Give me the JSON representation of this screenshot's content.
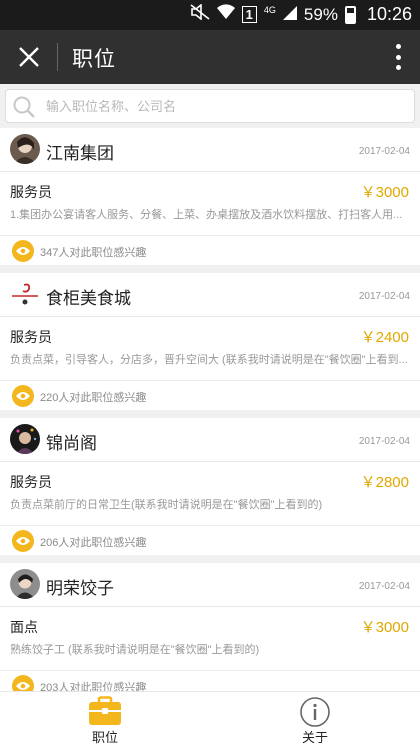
{
  "status_bar": {
    "network": "4G",
    "sim": "1",
    "battery": "59%",
    "time": "10:26"
  },
  "app_bar": {
    "title": "职位",
    "close_icon": "close-icon",
    "more_icon": "more-vertical-icon"
  },
  "search": {
    "placeholder": "输入职位名称、公司名",
    "value": ""
  },
  "jobs": [
    {
      "company": "江南集团",
      "date": "2017-02-04",
      "title": "服务员",
      "salary": "￥3000",
      "description": "1.集团办公宴请客人服务、分餐、上菜、办桌摆放及酒水饮料摆放、打扫客人用...",
      "interest": "347人对此职位感兴趣"
    },
    {
      "company": "食柜美食城",
      "date": "2017-02-04",
      "title": "服务员",
      "salary": "￥2400",
      "description": "负责点菜，引导客人，分店多，晋升空间大 (联系我时请说明是在\"餐饮圈\"上看到...",
      "interest": "220人对此职位感兴趣"
    },
    {
      "company": "锦尚阁",
      "date": "2017-02-04",
      "title": "服务员",
      "salary": "￥2800",
      "description": "负责点菜前厅的日常卫生(联系我时请说明是在\"餐饮圈\"上看到的)",
      "interest": "206人对此职位感兴趣"
    },
    {
      "company": "明荣饺子",
      "date": "2017-02-04",
      "title": "面点",
      "salary": "￥3000",
      "description": "熟练饺子工 (联系我时请说明是在\"餐饮圈\"上看到的)",
      "interest": "203人对此职位感兴趣"
    }
  ],
  "tab_bar": {
    "tabs": [
      {
        "label": "职位",
        "icon": "briefcase-icon",
        "active": true
      },
      {
        "label": "关于",
        "icon": "info-icon",
        "active": false
      }
    ]
  },
  "colors": {
    "accent": "#f3b61c",
    "salary": "#e0a800",
    "app_bar": "#303030"
  }
}
